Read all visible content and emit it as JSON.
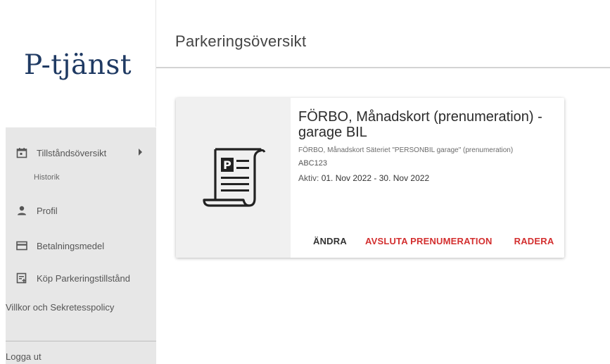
{
  "app": {
    "logo": "P-tjänst"
  },
  "header": {
    "title": "Parkeringsöversikt"
  },
  "sidebar": {
    "items": [
      {
        "label": "Tillståndsöversikt",
        "icon": "calendar-icon"
      },
      {
        "label": "Historik"
      },
      {
        "label": "Profil",
        "icon": "person-icon"
      },
      {
        "label": "Betalningsmedel",
        "icon": "credit-card-icon"
      },
      {
        "label": "Köp Parkeringstillstånd",
        "icon": "add-document-icon"
      },
      {
        "label": "Villkor och Sekretesspolicy"
      },
      {
        "label": "Logga ut"
      }
    ]
  },
  "permit_card": {
    "icon": "parking-ticket-icon",
    "title": "FÖRBO, Månadskort (prenumeration) - garage BIL",
    "subtitle": "FÖRBO, Månadskort Säteriet \"PERSONBIL garage\" (prenumeration)",
    "plate": "ABC123",
    "active_label": "Aktiv:",
    "active_period": "01. Nov 2022 - 30. Nov 2022",
    "actions": {
      "edit": "ÄNDRA",
      "end_subscription": "AVSLUTA PRENUMERATION",
      "delete": "RADERA"
    }
  },
  "colors": {
    "logo": "#1f3a63",
    "danger": "#d32f2f",
    "sidebar_bg": "#e7e7e7"
  }
}
